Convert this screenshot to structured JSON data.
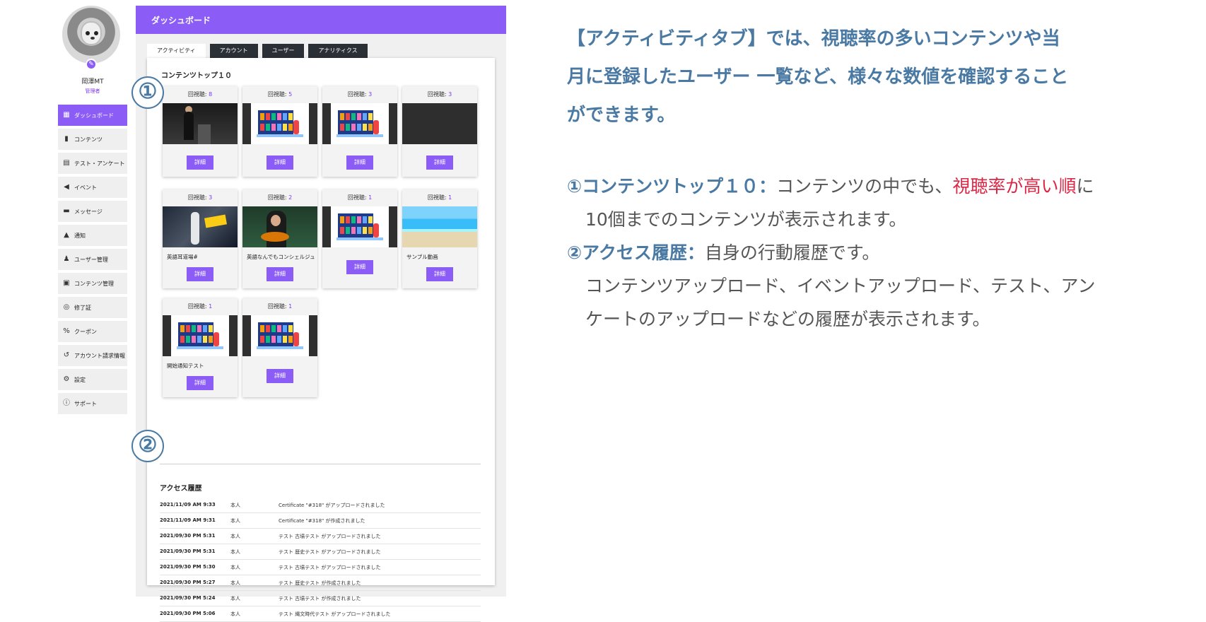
{
  "sidebar": {
    "user_name": "岡澤MT",
    "user_role": "管理者",
    "items": [
      {
        "label": "ダッシュボード",
        "icon": "grid-icon",
        "glyph": "▦",
        "active": true
      },
      {
        "label": "コンテンツ",
        "icon": "book-icon",
        "glyph": "▮",
        "active": false
      },
      {
        "label": "テスト・アンケート",
        "icon": "document-icon",
        "glyph": "▤",
        "active": false
      },
      {
        "label": "イベント",
        "icon": "megaphone-icon",
        "glyph": "◀",
        "active": false
      },
      {
        "label": "メッセージ",
        "icon": "chat-icon",
        "glyph": "▬",
        "active": false
      },
      {
        "label": "通知",
        "icon": "bell-icon",
        "glyph": "▲",
        "active": false
      },
      {
        "label": "ユーザー管理",
        "icon": "users-icon",
        "glyph": "♟",
        "active": false
      },
      {
        "label": "コンテンツ管理",
        "icon": "content-manage-icon",
        "glyph": "▣",
        "active": false
      },
      {
        "label": "修了証",
        "icon": "medal-icon",
        "glyph": "◎",
        "active": false
      },
      {
        "label": "クーポン",
        "icon": "percent-icon",
        "glyph": "%",
        "active": false
      },
      {
        "label": "アカウント請求情報",
        "icon": "history-icon",
        "glyph": "↺",
        "active": false
      },
      {
        "label": "設定",
        "icon": "gear-icon",
        "glyph": "⚙",
        "active": false
      },
      {
        "label": "サポート",
        "icon": "info-icon",
        "glyph": "ⓘ",
        "active": false
      }
    ]
  },
  "header": {
    "title": "ダッシュボード"
  },
  "tabs": [
    "アクティビティ",
    "アカウント",
    "ユーザー",
    "アナリティクス"
  ],
  "content_top": {
    "title": "コンテンツトップ１０",
    "views_label": "回視聴:",
    "detail_label": "詳細",
    "cards": [
      {
        "views": "8",
        "title": "",
        "thumb": "stage"
      },
      {
        "views": "5",
        "title": "",
        "thumb": "library"
      },
      {
        "views": "3",
        "title": "",
        "thumb": "library"
      },
      {
        "views": "3",
        "title": "",
        "thumb": "dark"
      },
      {
        "views": "3",
        "title": "英語耳道場#",
        "thumb": "crowd"
      },
      {
        "views": "2",
        "title": "英語なんでもコンシェルジュ",
        "thumb": "food"
      },
      {
        "views": "1",
        "title": "",
        "thumb": "library"
      },
      {
        "views": "1",
        "title": "サンプル動画",
        "thumb": "beach"
      },
      {
        "views": "1",
        "title": "開始通知テスト",
        "thumb": "library"
      },
      {
        "views": "1",
        "title": "",
        "thumb": "library"
      }
    ]
  },
  "access_history": {
    "title": "アクセス履歴",
    "rows": [
      {
        "date": "2021/11/09 AM 9:33",
        "user": "本人",
        "action": "Certificate \"#318\" がアップロードされました"
      },
      {
        "date": "2021/11/09 AM 9:31",
        "user": "本人",
        "action": "Certificate \"#318\" が作成されました"
      },
      {
        "date": "2021/09/30 PM 5:31",
        "user": "本人",
        "action": "テスト 古墳テスト がアップロードされました"
      },
      {
        "date": "2021/09/30 PM 5:31",
        "user": "本人",
        "action": "テスト 歴史テスト がアップロードされました"
      },
      {
        "date": "2021/09/30 PM 5:30",
        "user": "本人",
        "action": "テスト 古墳テスト がアップロードされました"
      },
      {
        "date": "2021/09/30 PM 5:27",
        "user": "本人",
        "action": "テスト 歴史テスト が作成されました"
      },
      {
        "date": "2021/09/30 PM 5:24",
        "user": "本人",
        "action": "テスト 古墳テスト が作成されました"
      },
      {
        "date": "2021/09/30 PM 5:06",
        "user": "本人",
        "action": "テスト 縄文時代テスト がアップロードされました"
      }
    ]
  },
  "markers": {
    "one": "①",
    "two": "②"
  },
  "explanation": {
    "heading_1": "【アクティビティタブ】では、視聴率の多いコンテンツや当",
    "heading_2": "月に登録したユーザー 一覧など、様々な数値を確認すること",
    "heading_3": "ができます。",
    "item1_label": "①コンテンツトップ１０：",
    "item1_text_a": "コンテンツの中でも、",
    "item1_highlight": "視聴率が高い順",
    "item1_text_b": "に",
    "item1_line2": "10個までのコンテンツが表示されます。",
    "item2_label": "②アクセス履歴：",
    "item2_text": "自身の行動履歴です。",
    "item2_line2": "コンテンツアップロード、イベントアップロード、テスト、アン",
    "item2_line3": "ケートのアップロードなどの履歴が表示されます。"
  },
  "colors": {
    "accent": "#8b5cf6",
    "label_blue": "#4a7aa3",
    "highlight_red": "#dc2645",
    "tab_dark": "#2b2f36"
  }
}
